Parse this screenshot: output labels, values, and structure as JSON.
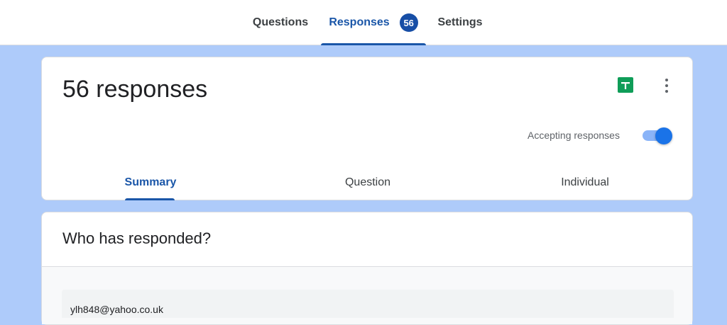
{
  "top_tabs": {
    "questions": "Questions",
    "responses": "Responses",
    "responses_badge": "56",
    "settings": "Settings"
  },
  "summary_card": {
    "title": "56 responses",
    "accepting_label": "Accepting responses",
    "accepting_on": true,
    "sheets_icon": "google-sheets-icon",
    "more_icon": "more-vertical-icon",
    "sub_tabs": {
      "summary": "Summary",
      "question": "Question",
      "individual": "Individual"
    }
  },
  "who_responded": {
    "title": "Who has responded?",
    "emails": [
      "ylh848@yahoo.co.uk"
    ]
  },
  "colors": {
    "accent": "#1a56a8",
    "page_background": "#aecbfa",
    "sheets_green": "#0f9d58",
    "toggle_on": "#1a73e8"
  }
}
